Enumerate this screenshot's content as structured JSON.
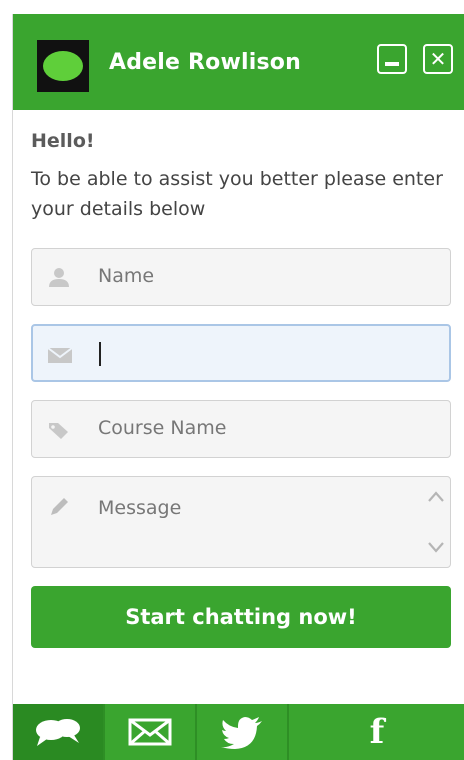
{
  "header": {
    "agent_name": "Adele Rowlison",
    "logo_icon": "brand-logo-icon",
    "minimize_icon": "minimize-icon",
    "close_icon": "close-icon",
    "close_glyph": "✕"
  },
  "greeting": {
    "hello": "Hello!",
    "intro": "To be able to assist you better please enter your details below"
  },
  "form": {
    "name": {
      "placeholder": "Name",
      "icon": "user-icon"
    },
    "email": {
      "value": "",
      "icon": "envelope-icon"
    },
    "course": {
      "placeholder": "Course Name",
      "icon": "tag-icon"
    },
    "message": {
      "placeholder": "Message",
      "icon": "pencil-icon"
    }
  },
  "start_button": {
    "label": "Start chatting now!"
  },
  "footer": {
    "tabs": [
      {
        "icon": "chat-bubbles-icon",
        "active": true
      },
      {
        "icon": "envelope-icon",
        "active": false
      },
      {
        "icon": "twitter-bird-icon",
        "active": false
      },
      {
        "icon": "facebook-icon",
        "glyph": "f",
        "active": false
      }
    ]
  },
  "colors": {
    "brand_green": "#3aa52f",
    "active_tab": "#2a8a22",
    "focus_border": "#aac6e6"
  }
}
